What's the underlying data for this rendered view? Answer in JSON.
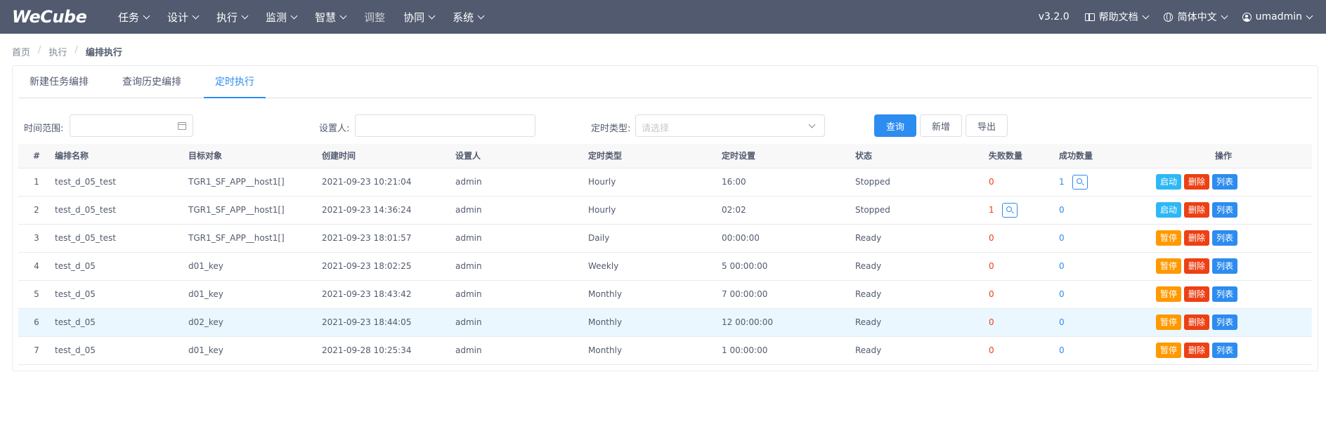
{
  "topbar": {
    "logo": "WeCube",
    "nav": [
      {
        "label": "任务",
        "dropdown": true,
        "disabled": false
      },
      {
        "label": "设计",
        "dropdown": true,
        "disabled": false
      },
      {
        "label": "执行",
        "dropdown": true,
        "disabled": false
      },
      {
        "label": "监测",
        "dropdown": true,
        "disabled": false
      },
      {
        "label": "智慧",
        "dropdown": true,
        "disabled": false
      },
      {
        "label": "调整",
        "dropdown": false,
        "disabled": true
      },
      {
        "label": "协同",
        "dropdown": true,
        "disabled": false
      },
      {
        "label": "系统",
        "dropdown": true,
        "disabled": false
      }
    ],
    "version": "v3.2.0",
    "help": "帮助文档",
    "language": "简体中文",
    "user": "umadmin"
  },
  "breadcrumb": [
    "首页",
    "执行",
    "编排执行"
  ],
  "tabs": [
    {
      "label": "新建任务编排",
      "active": false
    },
    {
      "label": "查询历史编排",
      "active": false
    },
    {
      "label": "定时执行",
      "active": true
    }
  ],
  "filters": {
    "time_range_label": "时间范围:",
    "setter_label": "设置人:",
    "timer_type_label": "定时类型:",
    "timer_type_placeholder": "请选择",
    "search_btn": "查询",
    "add_btn": "新增",
    "export_btn": "导出"
  },
  "table": {
    "columns": [
      "#",
      "编排名称",
      "目标对象",
      "创建时间",
      "设置人",
      "定时类型",
      "定时设置",
      "状态",
      "失败数量",
      "成功数量",
      "操作"
    ],
    "rows": [
      {
        "idx": "1",
        "name": "test_d_05_test",
        "target": "TGR1_SF_APP__host1[]",
        "created": "2021-09-23 10:21:04",
        "setter": "admin",
        "type": "Hourly",
        "setting": "16:00",
        "status": "Stopped",
        "fail": "0",
        "success": "1",
        "fail_search": false,
        "success_search": true,
        "action": "启动",
        "highlight": false
      },
      {
        "idx": "2",
        "name": "test_d_05_test",
        "target": "TGR1_SF_APP__host1[]",
        "created": "2021-09-23 14:36:24",
        "setter": "admin",
        "type": "Hourly",
        "setting": "02:02",
        "status": "Stopped",
        "fail": "1",
        "success": "0",
        "fail_search": true,
        "success_search": false,
        "action": "启动",
        "highlight": false
      },
      {
        "idx": "3",
        "name": "test_d_05_test",
        "target": "TGR1_SF_APP__host1[]",
        "created": "2021-09-23 18:01:57",
        "setter": "admin",
        "type": "Daily",
        "setting": "00:00:00",
        "status": "Ready",
        "fail": "0",
        "success": "0",
        "fail_search": false,
        "success_search": false,
        "action": "暂停",
        "highlight": false
      },
      {
        "idx": "4",
        "name": "test_d_05",
        "target": "d01_key",
        "created": "2021-09-23 18:02:25",
        "setter": "admin",
        "type": "Weekly",
        "setting": "5 00:00:00",
        "status": "Ready",
        "fail": "0",
        "success": "0",
        "fail_search": false,
        "success_search": false,
        "action": "暂停",
        "highlight": false
      },
      {
        "idx": "5",
        "name": "test_d_05",
        "target": "d01_key",
        "created": "2021-09-23 18:43:42",
        "setter": "admin",
        "type": "Monthly",
        "setting": "7 00:00:00",
        "status": "Ready",
        "fail": "0",
        "success": "0",
        "fail_search": false,
        "success_search": false,
        "action": "暂停",
        "highlight": false
      },
      {
        "idx": "6",
        "name": "test_d_05",
        "target": "d02_key",
        "created": "2021-09-23 18:44:05",
        "setter": "admin",
        "type": "Monthly",
        "setting": "12 00:00:00",
        "status": "Ready",
        "fail": "0",
        "success": "0",
        "fail_search": false,
        "success_search": false,
        "action": "暂停",
        "highlight": true
      },
      {
        "idx": "7",
        "name": "test_d_05",
        "target": "d01_key",
        "created": "2021-09-28 10:25:34",
        "setter": "admin",
        "type": "Monthly",
        "setting": "1 00:00:00",
        "status": "Ready",
        "fail": "0",
        "success": "0",
        "fail_search": false,
        "success_search": false,
        "action": "暂停",
        "highlight": false
      }
    ],
    "delete_label": "删除",
    "list_label": "列表"
  },
  "colors": {
    "topbar": "#515a6e",
    "primary": "#2d8cf0",
    "start": "#2db7f5",
    "pause": "#ff9900",
    "danger": "#ed4014"
  }
}
